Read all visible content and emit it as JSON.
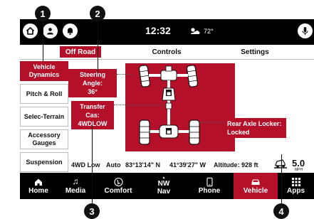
{
  "callouts": [
    "1",
    "2",
    "3",
    "4"
  ],
  "status": {
    "time": "12:32",
    "temperature": "72°"
  },
  "tabs": [
    {
      "label": "Off Road"
    },
    {
      "label": "Controls"
    },
    {
      "label": "Settings"
    }
  ],
  "sidebar": [
    {
      "label": "Vehicle Dynamics"
    },
    {
      "label": "Pitch & Roll"
    },
    {
      "label": "Selec-Terrain"
    },
    {
      "label": "Accessory Gauges"
    },
    {
      "label": "Suspension"
    }
  ],
  "diagram": {
    "steering": {
      "title": "Steering Angle:",
      "value": "36°"
    },
    "transfer": {
      "title": "Transfer Cas:",
      "value": "4WDLOW"
    },
    "rear_axle": {
      "title": "Rear Axle Locker:",
      "value": "Locked"
    }
  },
  "info": {
    "mode": "4WD Low",
    "auto": "Auto",
    "latitude": "83°13'14\" N",
    "longitude": "41°39'27\" W",
    "altitude": "Altitude: 928 ft",
    "speed": "5.0",
    "speed_unit": "MPH"
  },
  "nav": [
    {
      "label": "Home",
      "icon": "home-icon"
    },
    {
      "label": "Media",
      "icon": "music-note-icon"
    },
    {
      "label": "Comfort",
      "icon": "seat-heat-icon"
    },
    {
      "label": "Nav",
      "icon": "compass-icon",
      "heading": "NW"
    },
    {
      "label": "Phone",
      "icon": "phone-icon"
    },
    {
      "label": "Vehicle",
      "icon": "car-icon"
    },
    {
      "label": "Apps",
      "icon": "apps-grid-icon"
    }
  ],
  "colors": {
    "accent": "#b4102a",
    "bar": "#000000"
  }
}
